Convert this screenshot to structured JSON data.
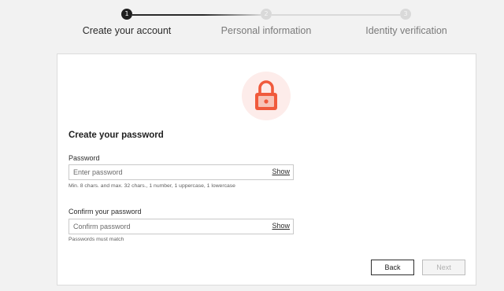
{
  "stepper": {
    "steps": [
      {
        "number": "1",
        "label": "Create your account",
        "state": "active"
      },
      {
        "number": "2",
        "label": "Personal information",
        "state": "inactive"
      },
      {
        "number": "3",
        "label": "Identity verification",
        "state": "inactive"
      }
    ]
  },
  "form": {
    "title": "Create your password",
    "password": {
      "label": "Password",
      "placeholder": "Enter password",
      "value": "",
      "toggle_label": "Show",
      "hint": "Min. 8 chars. and max. 32 chars., 1 number, 1 uppercase, 1 lowercase"
    },
    "confirm_password": {
      "label": "Confirm your password",
      "placeholder": "Confirm password",
      "value": "",
      "toggle_label": "Show",
      "hint": "Passwords must match"
    },
    "back_label": "Back",
    "next_label": "Next",
    "next_enabled": false
  },
  "icon": {
    "name": "lock-icon",
    "color": "#f05a3c",
    "background": "#fdecea"
  },
  "colors": {
    "active_step": "#1f1f1f",
    "inactive_step": "#d9d9d9",
    "page_bg": "#f2f2f2"
  }
}
